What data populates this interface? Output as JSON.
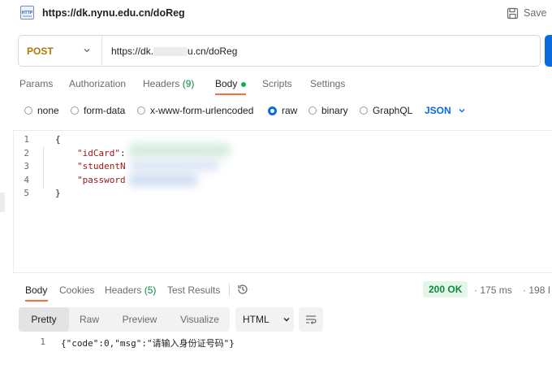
{
  "request": {
    "title": "https://dk.nynu.edu.cn/doReg",
    "save_label": "Save",
    "icon": "http-icon"
  },
  "url_bar": {
    "method": "POST",
    "url_prefix": "https://dk.",
    "url_suffix": "u.cn/doReg"
  },
  "request_tabs": [
    {
      "label": "Params"
    },
    {
      "label": "Authorization"
    },
    {
      "label": "Headers",
      "count": "(9)"
    },
    {
      "label": "Body",
      "active": true
    },
    {
      "label": "Scripts"
    },
    {
      "label": "Settings"
    }
  ],
  "body_types": [
    {
      "label": "none"
    },
    {
      "label": "form-data"
    },
    {
      "label": "x-www-form-urlencoded"
    },
    {
      "label": "raw",
      "checked": true
    },
    {
      "label": "binary"
    },
    {
      "label": "GraphQL"
    }
  ],
  "body_format": "JSON",
  "editor": {
    "line_numbers": [
      "1",
      "2",
      "3",
      "4",
      "5"
    ],
    "open_brace": "{",
    "key_idcard": "\"idCard\"",
    "colon": ":",
    "key_student": "\"studentN",
    "key_password": "\"password",
    "close_brace": "}"
  },
  "response": {
    "tabs": [
      {
        "label": "Body",
        "active": true
      },
      {
        "label": "Cookies"
      },
      {
        "label": "Headers",
        "count": "(5)"
      },
      {
        "label": "Test Results"
      }
    ],
    "status": "200 OK",
    "time": "175 ms",
    "size": "198 I",
    "view_modes": [
      "Pretty",
      "Raw",
      "Preview",
      "Visualize"
    ],
    "format": "HTML",
    "line_number": "1",
    "body_text": "{\"code\":0,\"msg\":\"请输入身份证号码\"}"
  },
  "colors": {
    "accent_orange": "#ff6c37",
    "primary_blue": "#0a6bde",
    "success_green": "#0b8a3f",
    "method_post": "#ad7a03"
  }
}
